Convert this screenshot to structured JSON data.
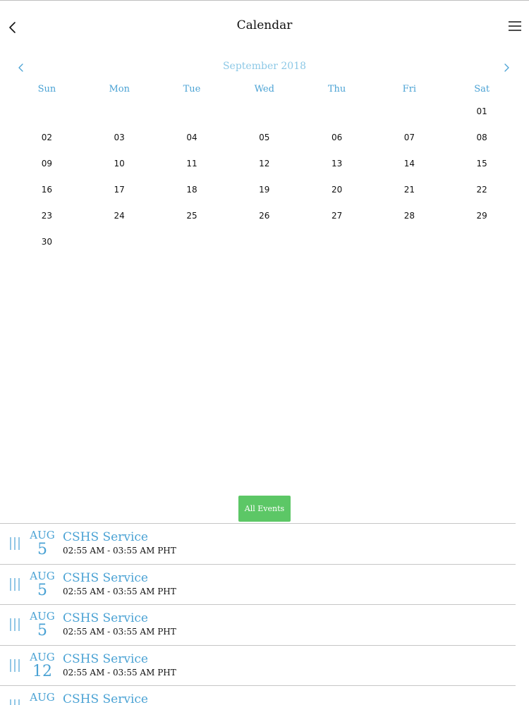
{
  "header": {
    "title": "Calendar"
  },
  "calendar": {
    "month_label": "September 2018",
    "weekdays": [
      "Sun",
      "Mon",
      "Tue",
      "Wed",
      "Thu",
      "Fri",
      "Sat"
    ],
    "weeks": [
      [
        "",
        "",
        "",
        "",
        "",
        "",
        "01"
      ],
      [
        "02",
        "03",
        "04",
        "05",
        "06",
        "07",
        "08"
      ],
      [
        "09",
        "10",
        "11",
        "12",
        "13",
        "14",
        "15"
      ],
      [
        "16",
        "17",
        "18",
        "19",
        "20",
        "21",
        "22"
      ],
      [
        "23",
        "24",
        "25",
        "26",
        "27",
        "28",
        "29"
      ],
      [
        "30",
        "",
        "",
        "",
        "",
        "",
        ""
      ]
    ]
  },
  "all_events_label": "All Events",
  "events": [
    {
      "month": "AUG",
      "day": "5",
      "title": "CSHS Service",
      "time": "02:55 AM - 03:55 AM PHT"
    },
    {
      "month": "AUG",
      "day": "5",
      "title": "CSHS Service",
      "time": "02:55 AM - 03:55 AM PHT"
    },
    {
      "month": "AUG",
      "day": "5",
      "title": "CSHS Service",
      "time": "02:55 AM - 03:55 AM PHT"
    },
    {
      "month": "AUG",
      "day": "12",
      "title": "CSHS Service",
      "time": "02:55 AM - 03:55 AM PHT"
    },
    {
      "month": "AUG",
      "day": "",
      "title": "CSHS Service",
      "time": ""
    }
  ],
  "colors": {
    "accent": "#4aa2d4",
    "month_label": "#8cc8e6",
    "button_green": "#5cc766",
    "divider": "#c6c6c6"
  }
}
